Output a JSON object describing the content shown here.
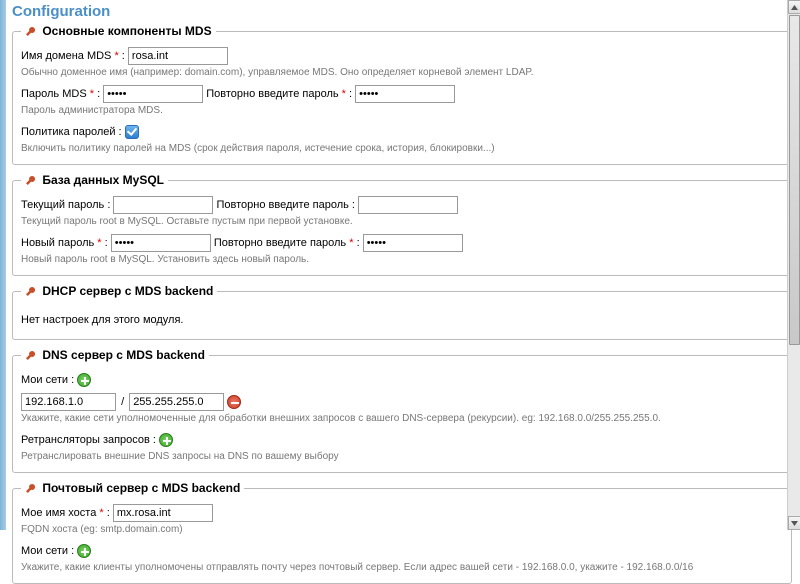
{
  "page_title": "Configuration",
  "sections": {
    "mds_core": {
      "legend": "Основные компоненты MDS",
      "domain_label": "Имя домена MDS",
      "domain_value": "rosa.int",
      "domain_hint": "Обычно доменное имя (например: domain.com), управляемое MDS. Оно определяет корневой элемент LDAP.",
      "pass_label": "Пароль MDS",
      "pass_value": "•••••",
      "pass2_label": "Повторно введите пароль",
      "pass2_value": "•••••",
      "pass_hint": "Пароль администратора MDS.",
      "policy_label": "Политика паролей :",
      "policy_hint": "Включить политику паролей на MDS (срок действия пароля, истечение срока, история, блокировки...)"
    },
    "mysql": {
      "legend": "База данных MySQL",
      "cur_label": "Текущий пароль :",
      "cur2_label": "Повторно введите пароль :",
      "cur_hint": "Текущий пароль root в MySQL. Оставьте пустым при первой установке.",
      "new_label": "Новый пароль",
      "new_value": "•••••",
      "new2_label": "Повторно введите пароль",
      "new2_value": "•••••",
      "new_hint": "Новый пароль root в MySQL. Установить здесь новый пароль."
    },
    "dhcp": {
      "legend": "DHCP сервер с MDS backend",
      "empty": "Нет настроек для этого модуля."
    },
    "dns": {
      "legend": "DNS сервер с MDS backend",
      "nets_label": "Мои сети :",
      "net_ip": "192.168.1.0",
      "net_mask": "255.255.255.0",
      "nets_hint": "Укажите, какие сети уполномоченные для обработки внешних запросов с вашего DNS-сервера (рекурсии). eg: 192.168.0.0/255.255.255.0.",
      "relay_label": "Ретрансляторы запросов :",
      "relay_hint": "Ретранслировать внешние DNS запросы на DNS по вашему выбору"
    },
    "mail": {
      "legend": "Почтовый сервер с MDS backend",
      "host_label": "Мое имя хоста",
      "host_value": "mx.rosa.int",
      "host_hint": "FQDN хоста (eg: smtp.domain.com)",
      "nets_label": "Мои сети :",
      "nets_hint": "Укажите, какие клиенты уполномочены отправлять почту через почтовый сервер. Если адрес вашей сети - 192.168.0.0, укажите - 192.168.0.0/16"
    }
  }
}
